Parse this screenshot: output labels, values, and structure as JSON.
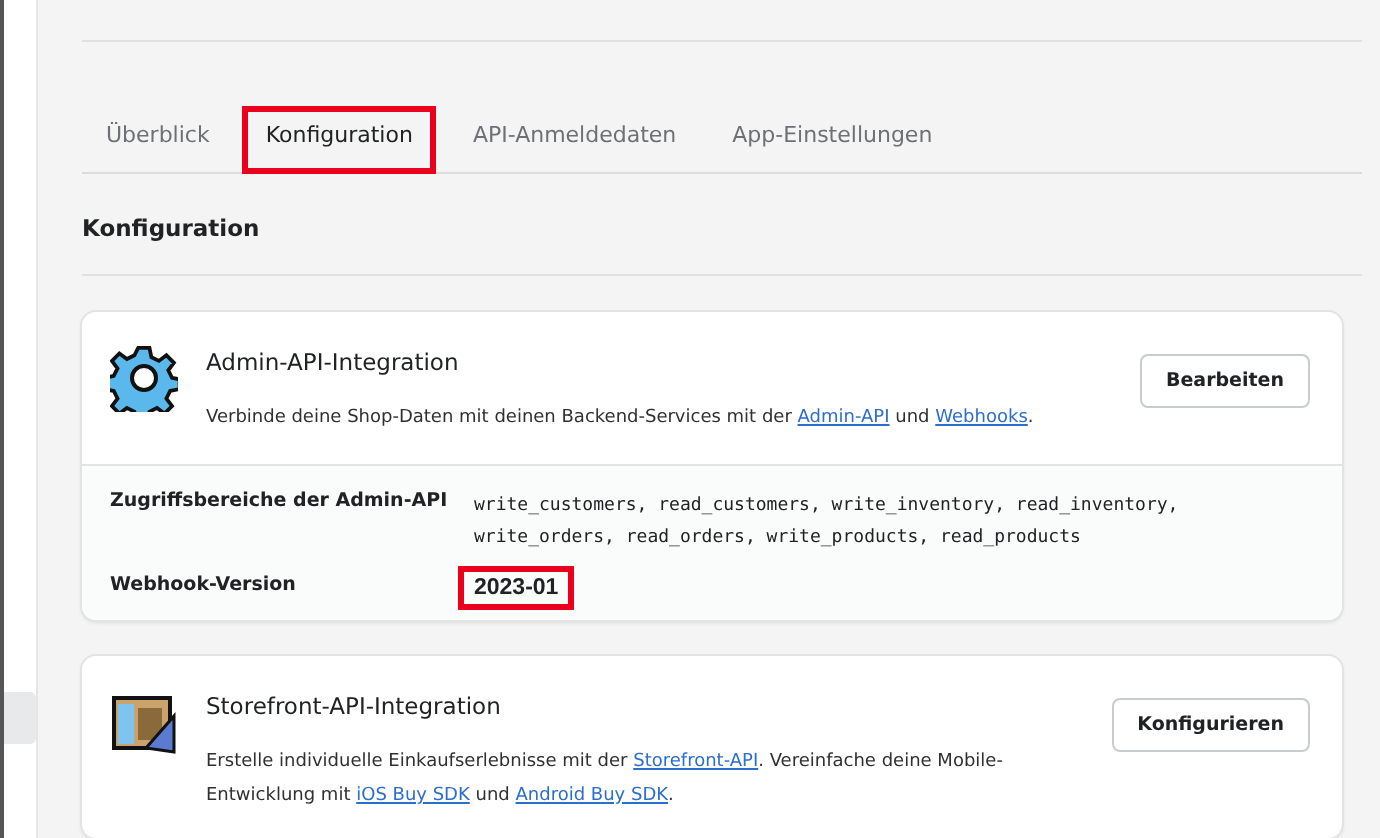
{
  "tabs": [
    {
      "label": "Überblick",
      "selected": false,
      "highlighted": false
    },
    {
      "label": "Konfiguration",
      "selected": true,
      "highlighted": true
    },
    {
      "label": "API-Anmeldedaten",
      "selected": false,
      "highlighted": false
    },
    {
      "label": "App-Einstellungen",
      "selected": false,
      "highlighted": false
    }
  ],
  "section_title": "Konfiguration",
  "cards": [
    {
      "kind": "admin",
      "title": "Admin-API-Integration",
      "description": [
        {
          "kind": "text",
          "text": "Verbinde deine Shop-Daten mit deinen Backend-Services mit der"
        },
        {
          "kind": "link",
          "text": "Admin-API"
        },
        {
          "kind": "text",
          "text": "und"
        },
        {
          "kind": "link",
          "text": "Webhooks"
        },
        {
          "kind": "text",
          "text": "."
        }
      ],
      "button": "Bearbeiten",
      "details": [
        {
          "label": "Zugriffsbereiche der Admin-API",
          "value": "write_customers, read_customers, write_inventory, read_inventory, write_orders, read_orders, write_products, read_products",
          "kind": "mono",
          "highlighted": false
        },
        {
          "label": "Webhook-Version",
          "value": "2023-01",
          "kind": "bold",
          "highlighted": true
        }
      ]
    },
    {
      "kind": "storefront",
      "title": "Storefront-API-Integration",
      "description": [
        {
          "kind": "text",
          "text": "Erstelle individuelle Einkaufserlebnisse mit der"
        },
        {
          "kind": "link",
          "text": "Storefront-API"
        },
        {
          "kind": "text",
          "text": ". Vereinfache deine Mobile-Entwicklung mit"
        },
        {
          "kind": "link",
          "text": "iOS Buy SDK"
        },
        {
          "kind": "text",
          "text": "und"
        },
        {
          "kind": "link",
          "text": "Android Buy SDK"
        },
        {
          "kind": "text",
          "text": "."
        }
      ],
      "button": "Konfigurieren"
    }
  ]
}
